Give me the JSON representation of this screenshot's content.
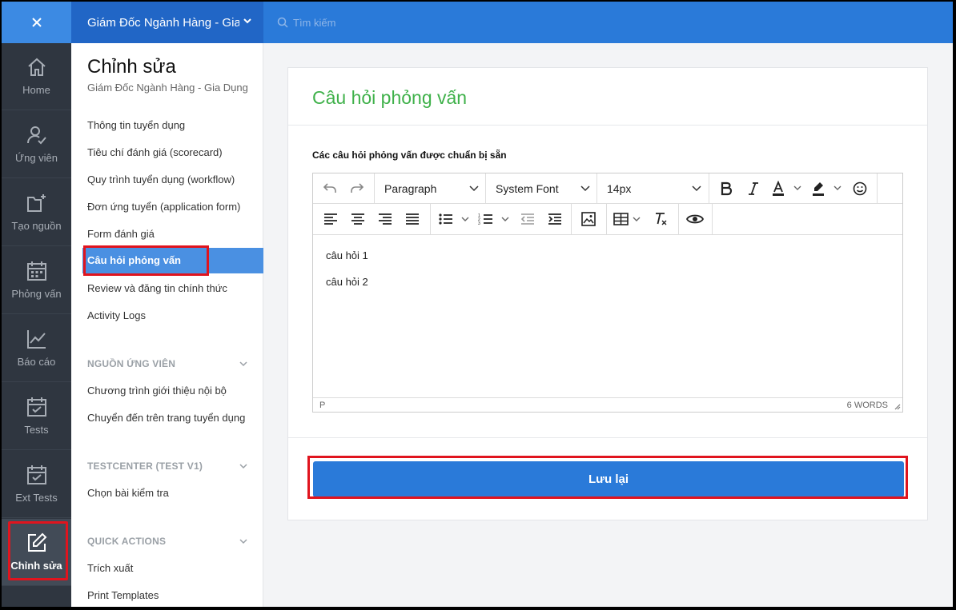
{
  "topbar": {
    "close_icon": "close-icon",
    "job_title": "Giám Đốc Ngành Hàng - Gia Dụng",
    "search_placeholder": "Tìm kiếm"
  },
  "rail": {
    "items": [
      {
        "label": "Home",
        "icon": "home-icon"
      },
      {
        "label": "Ứng viên",
        "icon": "user-check-icon"
      },
      {
        "label": "Tạo nguồn",
        "icon": "folder-plus-icon"
      },
      {
        "label": "Phỏng vấn",
        "icon": "calendar-icon"
      },
      {
        "label": "Báo cáo",
        "icon": "chart-line-icon"
      },
      {
        "label": "Tests",
        "icon": "calendar-check-icon"
      },
      {
        "label": "Ext Tests",
        "icon": "calendar-check-icon"
      },
      {
        "label": "Chỉnh sửa",
        "icon": "edit-icon"
      }
    ]
  },
  "sidebar": {
    "title": "Chỉnh sửa",
    "subtitle": "Giám Đốc Ngành Hàng - Gia Dụng",
    "links": [
      "Thông tin tuyển dụng",
      "Tiêu chí đánh giá (scorecard)",
      "Quy trình tuyển dụng (workflow)",
      "Đơn ứng tuyển (application form)",
      "Form đánh giá",
      "Câu hỏi phỏng vấn",
      "Review và đăng tin chính thức",
      "Activity Logs"
    ],
    "sections": [
      {
        "title": "NGUỒN ỨNG VIÊN",
        "links": [
          "Chương trình giới thiệu nội bộ",
          "Chuyển đến trên trang tuyển dụng"
        ]
      },
      {
        "title": "TESTCENTER (TEST V1)",
        "links": [
          "Chọn bài kiểm tra"
        ]
      },
      {
        "title": "QUICK ACTIONS",
        "links": [
          "Trích xuất",
          "Print Templates"
        ]
      }
    ]
  },
  "card": {
    "title": "Câu hỏi phỏng vấn",
    "field_label": "Các câu hỏi phỏng vấn được chuẩn bị sẵn",
    "editor": {
      "block_format": "Paragraph",
      "font_family": "System Font",
      "font_size": "14px",
      "content": [
        "câu hỏi 1",
        "câu hỏi 2"
      ],
      "status_path": "P",
      "word_count": "6 WORDS"
    },
    "save_label": "Lưu lại"
  },
  "colors": {
    "topbar": "#2a7ad9",
    "rail": "#2f3640",
    "title_green": "#3fb14a",
    "highlight_red": "#e0141e",
    "active_blue": "#4a90e2"
  }
}
